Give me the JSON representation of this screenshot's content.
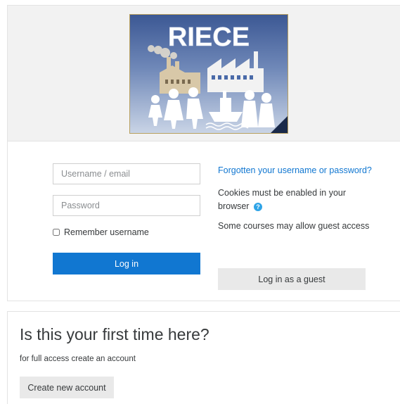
{
  "logo": {
    "text": "RIECE",
    "icon": "riece-logo"
  },
  "login": {
    "username_placeholder": "Username / email",
    "password_placeholder": "Password",
    "remember_label": "Remember username",
    "remember_checked": false,
    "login_button": "Log in",
    "forgot_link": "Forgotten your username or password?",
    "cookies_text": "Cookies must be enabled in your browser",
    "help_icon": "question-circle-icon",
    "guest_text": "Some courses may allow guest access",
    "guest_button": "Log in as a guest"
  },
  "signup": {
    "title": "Is this your first time here?",
    "description": "for full access create an account",
    "button": "Create new account"
  },
  "colors": {
    "primary": "#1177d1",
    "link": "#1177d1",
    "help_icon": "#2fa4e7",
    "secondary_button": "#e9e9e9",
    "logo_band": "#f2f2f2"
  }
}
